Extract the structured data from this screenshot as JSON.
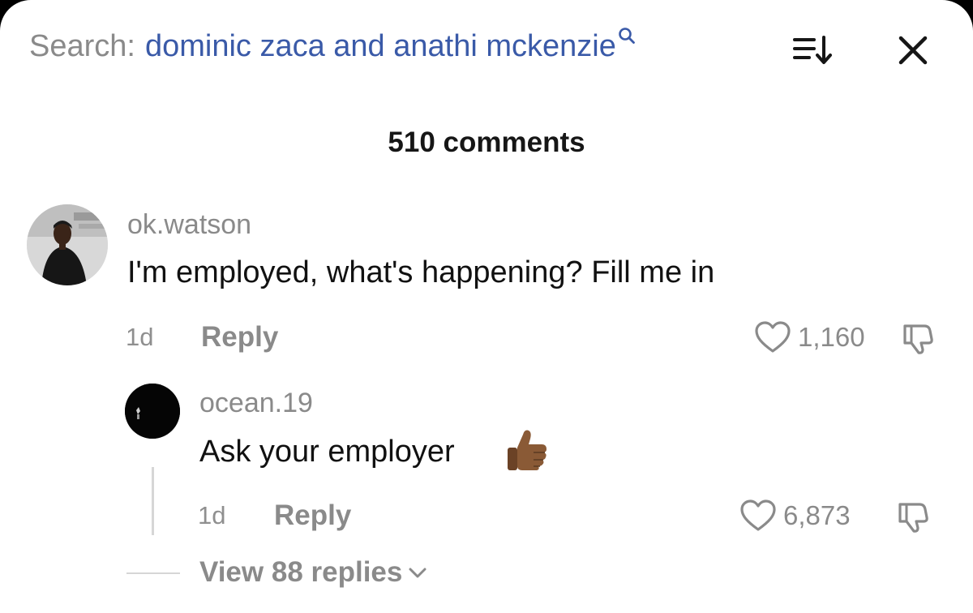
{
  "header": {
    "search_prefix": "Search:",
    "search_query": "dominic zaca and anathi mckenzie",
    "icons": {
      "search": "search-icon",
      "sort": "sort-icon",
      "close": "close-icon"
    }
  },
  "comments_count_label": "510 comments",
  "comments": [
    {
      "username": "ok.watson",
      "text": "I'm employed, what's happening? Fill me in",
      "time": "1d",
      "reply_label": "Reply",
      "likes": "1,160"
    },
    {
      "username": "ocean.19",
      "text": "Ask your employer",
      "emoji": "thumbs-up-medium-dark-skin-tone",
      "time": "1d",
      "reply_label": "Reply",
      "likes": "6,873"
    }
  ],
  "view_replies_label": "View 88 replies",
  "colors": {
    "accent_link": "#3a5aa8",
    "muted_text": "#8a8a8a",
    "primary_text": "#111111",
    "background": "#ffffff"
  }
}
